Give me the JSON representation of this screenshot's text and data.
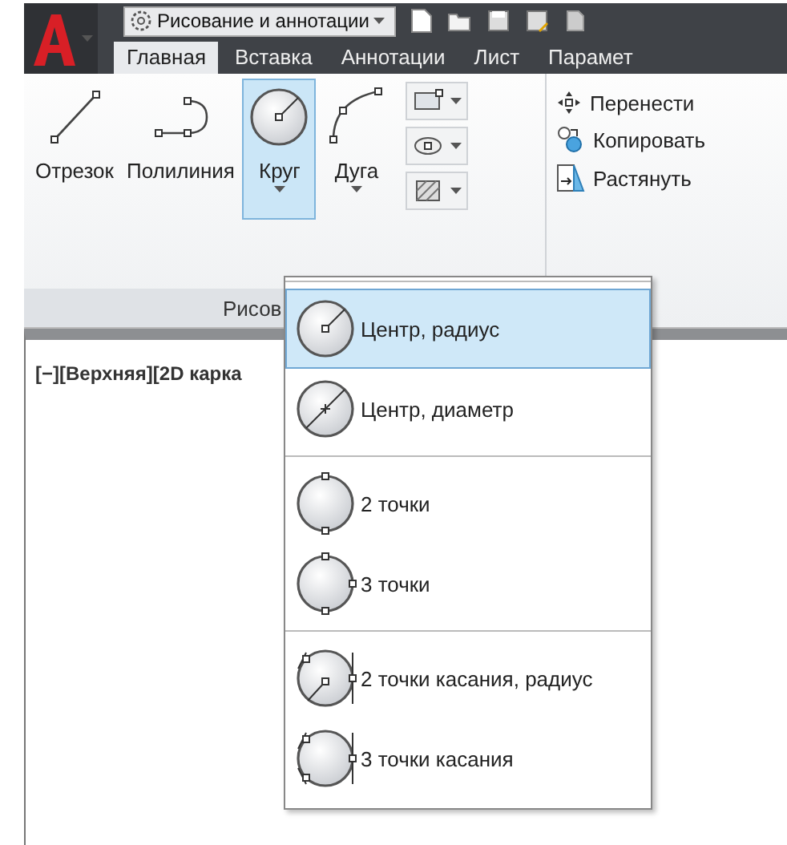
{
  "quick_access": {
    "workspace": "Рисование и аннотации"
  },
  "tabs": [
    {
      "label": "Главная",
      "selected": true
    },
    {
      "label": "Вставка",
      "selected": false
    },
    {
      "label": "Аннотации",
      "selected": false
    },
    {
      "label": "Лист",
      "selected": false
    },
    {
      "label": "Парамет",
      "selected": false
    }
  ],
  "draw_panel": {
    "tools": [
      {
        "kind": "line",
        "label": "Отрезок",
        "selected": false,
        "dropdown": false
      },
      {
        "kind": "polyline",
        "label": "Полилиния",
        "selected": false,
        "dropdown": false
      },
      {
        "kind": "circle",
        "label": "Круг",
        "selected": true,
        "dropdown": true
      },
      {
        "kind": "arc",
        "label": "Дуга",
        "selected": false,
        "dropdown": true
      }
    ],
    "small_tools": [
      {
        "kind": "rectangle"
      },
      {
        "kind": "ellipse"
      },
      {
        "kind": "hatch"
      }
    ],
    "title": "Рисов"
  },
  "modify_panel": {
    "tools": [
      {
        "kind": "move",
        "label": "Перенести"
      },
      {
        "kind": "copy",
        "label": "Копировать"
      },
      {
        "kind": "stretch",
        "label": "Растянуть"
      }
    ]
  },
  "viewport": {
    "label": "[−][Верхняя][2D карка"
  },
  "circle_menu": {
    "groups": [
      {
        "items": [
          {
            "kind": "center-radius",
            "label": "Центр, радиус",
            "selected": true
          },
          {
            "kind": "center-diameter",
            "label": "Центр, диаметр",
            "selected": false
          }
        ]
      },
      {
        "items": [
          {
            "kind": "two-point",
            "label": "2 точки",
            "selected": false
          },
          {
            "kind": "three-point",
            "label": "3 точки",
            "selected": false
          }
        ]
      },
      {
        "items": [
          {
            "kind": "tan-tan-radius",
            "label": "2 точки касания, радиус",
            "selected": false
          },
          {
            "kind": "tan-tan-tan",
            "label": "3 точки касания",
            "selected": false
          }
        ]
      }
    ]
  }
}
